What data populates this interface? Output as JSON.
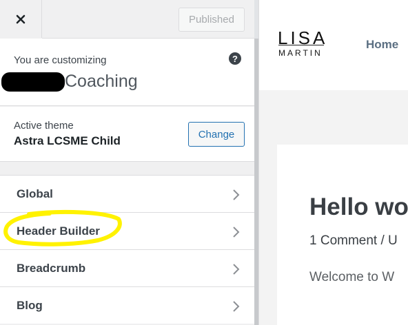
{
  "header": {
    "close_label": "Close",
    "published_label": "Published"
  },
  "info": {
    "customizing_label": "You are customizing",
    "help_label": "?",
    "site_name_visible": "Coaching"
  },
  "theme": {
    "active_label": "Active theme",
    "name": "Astra LCSME Child",
    "change_label": "Change"
  },
  "menu": [
    {
      "label": "Global"
    },
    {
      "label": "Header Builder",
      "highlighted": true
    },
    {
      "label": "Breadcrumb"
    },
    {
      "label": "Blog"
    }
  ],
  "preview": {
    "logo_top": "LISA",
    "logo_bottom": "MARTIN",
    "nav_home": "Home",
    "post_title": "Hello wo",
    "post_meta": "1 Comment / U",
    "post_excerpt": "Welcome to W"
  },
  "colors": {
    "accent": "#2271b1",
    "highlight": "#fff200"
  }
}
